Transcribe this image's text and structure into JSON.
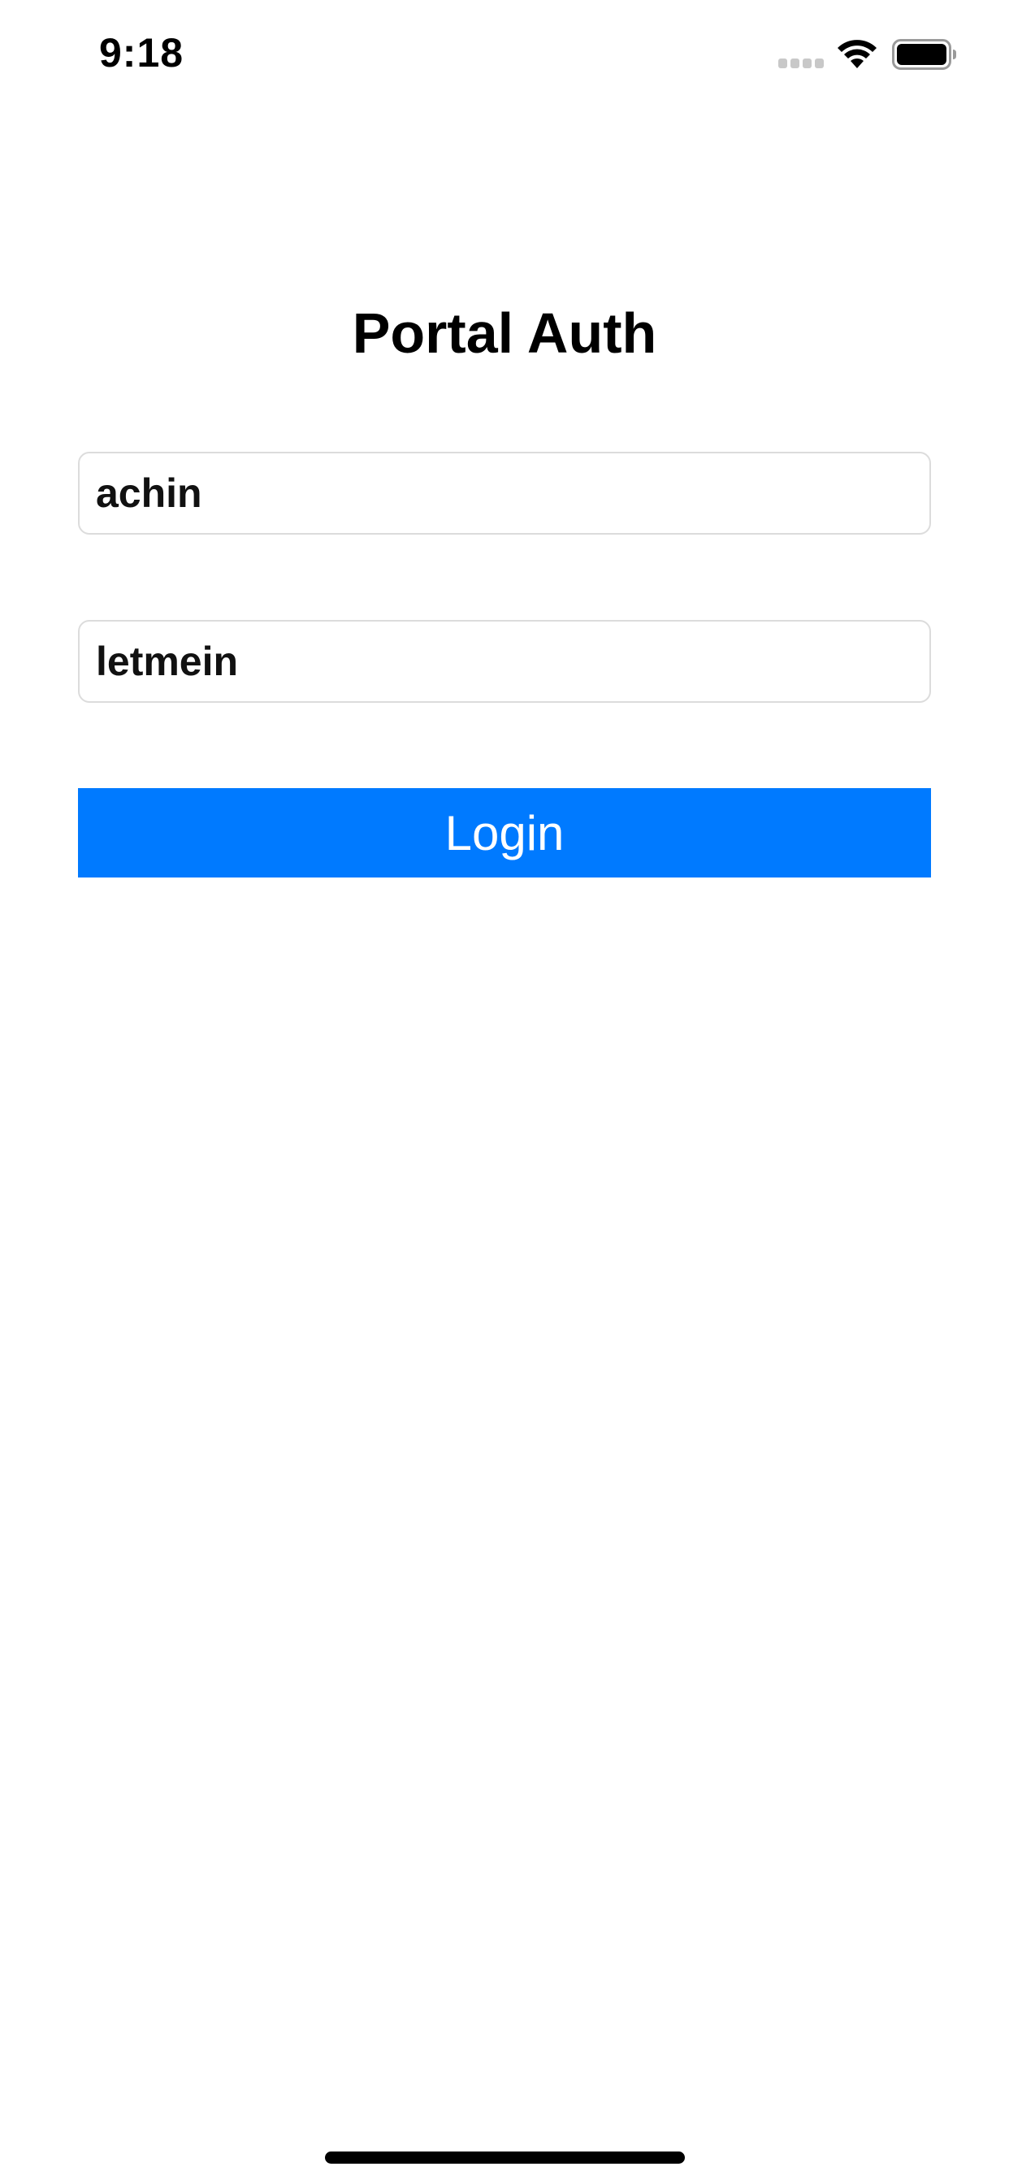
{
  "status_bar": {
    "time": "9:18",
    "icons": [
      "cellular-signal-icon",
      "wifi-icon",
      "battery-icon"
    ]
  },
  "screen": {
    "title": "Portal Auth"
  },
  "form": {
    "username_value": "achin",
    "password_value": "letmein",
    "login_label": "Login"
  },
  "colors": {
    "accent": "#007aff",
    "field_border": "#dcdcdc",
    "signal_inactive": "#c8c8c8"
  }
}
